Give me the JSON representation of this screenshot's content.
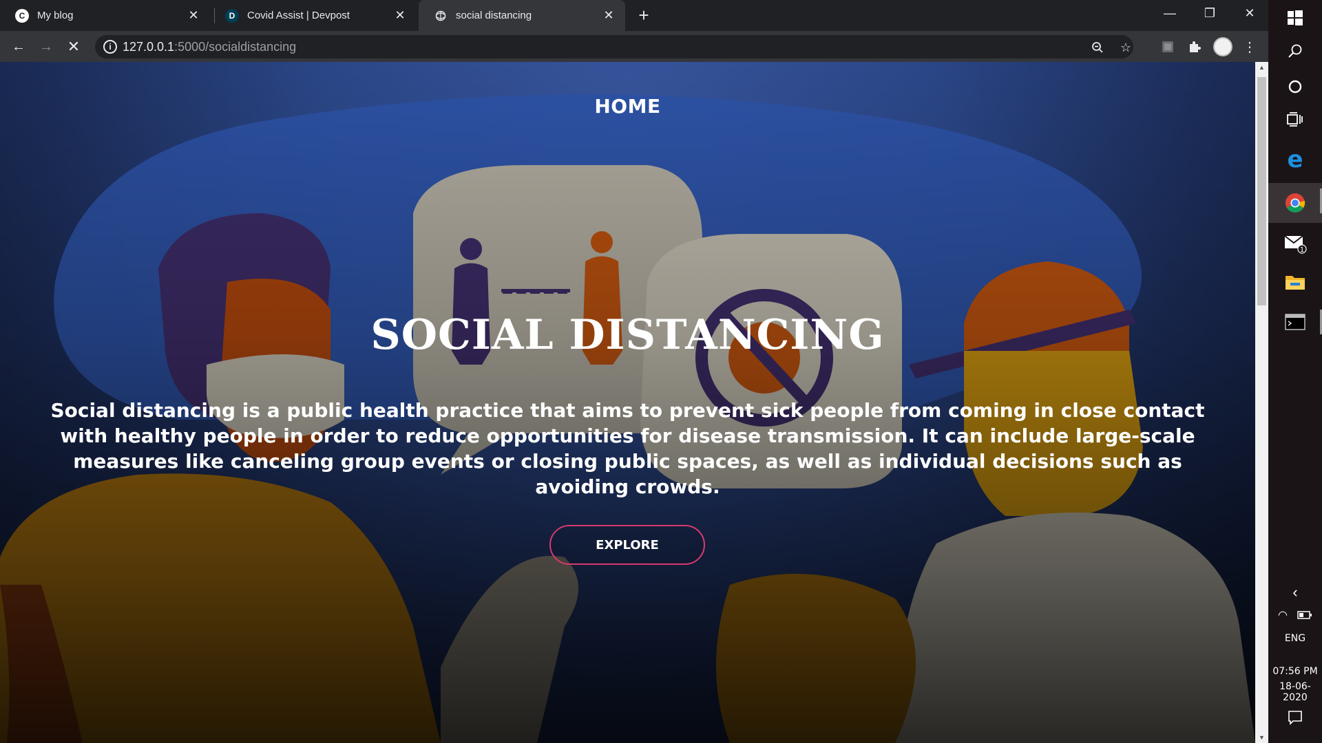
{
  "browser": {
    "tabs": [
      {
        "title": "My blog",
        "favicon": "blog-icon",
        "active": false
      },
      {
        "title": "Covid Assist | Devpost",
        "favicon": "D",
        "active": false
      },
      {
        "title": "social distancing",
        "favicon": "globe-icon",
        "active": true
      }
    ],
    "url_host": "127.0.0.1",
    "url_path": ":5000/socialdistancing"
  },
  "page": {
    "nav_home": "HOME",
    "title": "SOCIAL DISTANCING",
    "description": "Social distancing is a public health practice that aims to prevent sick people from coming in close contact with healthy people in order to reduce opportunities for disease transmission. It can include large-scale measures like canceling group events or closing public spaces, as well as individual decisions such as avoiding crowds.",
    "explore_label": "EXPLORE"
  },
  "taskbar": {
    "language": "ENG",
    "time": "07:56 PM",
    "date": "18-06-2020",
    "mail_badge": "1"
  },
  "colors": {
    "explore_border": "#d63a6e",
    "page_background": "#2d4a8e"
  }
}
